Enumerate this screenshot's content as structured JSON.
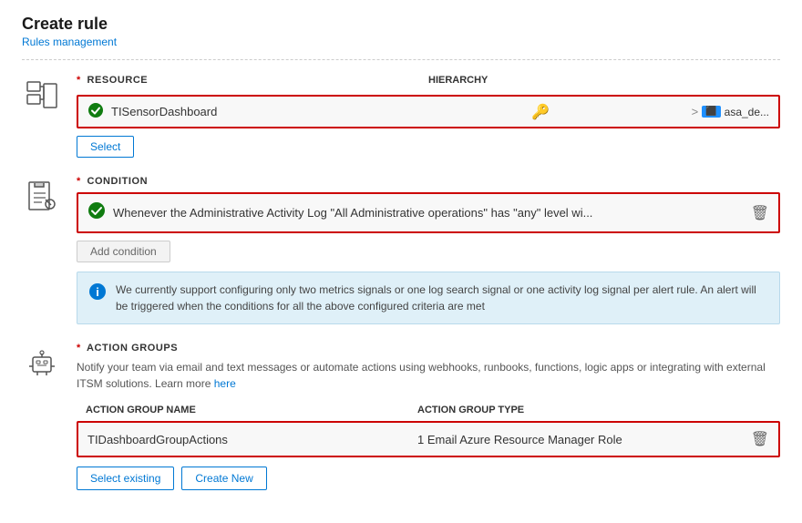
{
  "header": {
    "title": "Create rule",
    "breadcrumb": "Rules management"
  },
  "resource_section": {
    "label": "RESOURCE",
    "hierarchy_label": "HIERARCHY",
    "resource_name": "TISensorDashboard",
    "hierarchy_arrow": ">",
    "hierarchy_node": "asa_de...",
    "select_btn": "Select"
  },
  "condition_section": {
    "label": "CONDITION",
    "condition_text": "Whenever the Administrative Activity Log \"All Administrative operations\" has \"any\" level wi...",
    "add_condition_btn": "Add condition",
    "info_text": "We currently support configuring only two metrics signals or one log search signal or one activity log signal per alert rule. An alert will be triggered when the conditions for all the above configured criteria are met"
  },
  "action_groups_section": {
    "label": "ACTION GROUPS",
    "description": "Notify your team via email and text messages or automate actions using webhooks, runbooks, functions, logic apps or integrating with external ITSM solutions. Learn more",
    "learn_more_link": "here",
    "col_name": "ACTION GROUP NAME",
    "col_type": "ACTION GROUP TYPE",
    "row": {
      "name": "TIDashboardGroupActions",
      "type": "1 Email Azure Resource Manager Role"
    },
    "select_existing_btn": "Select existing",
    "create_new_btn": "Create New"
  }
}
